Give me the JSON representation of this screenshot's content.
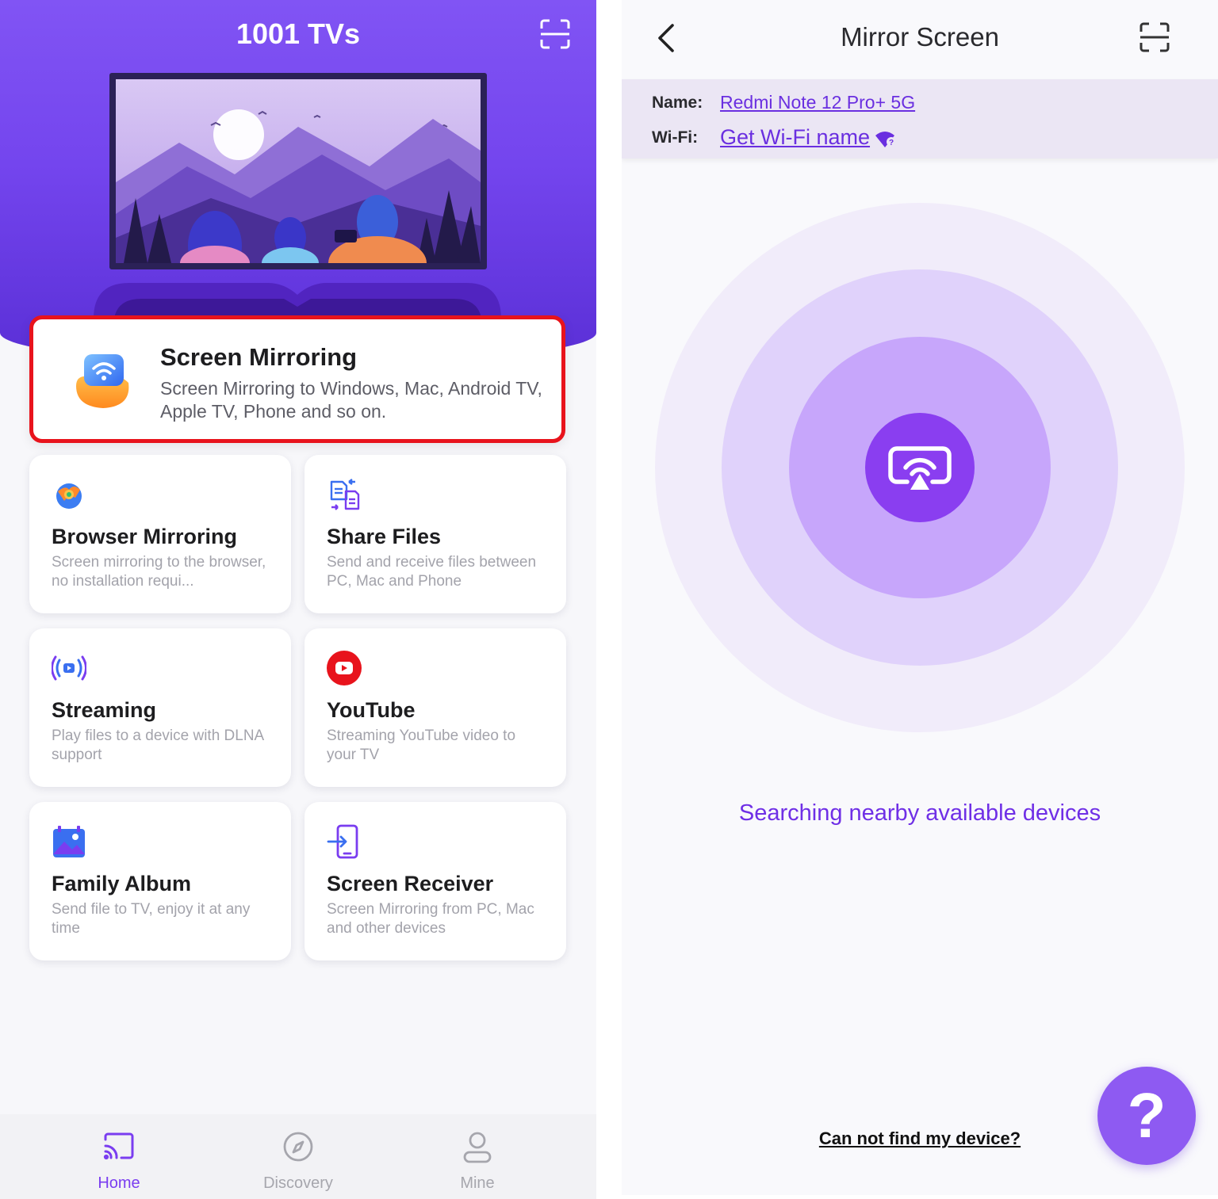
{
  "left": {
    "app_title": "1001 TVs",
    "main_feature": {
      "title": "Screen Mirroring",
      "description": "Screen Mirroring to Windows, Mac, Android TV, Apple TV, Phone and so on.",
      "highlight_color": "#e8131c"
    },
    "features": [
      {
        "title": "Browser Mirroring",
        "description": "Screen mirroring to the browser, no installation requi...",
        "icon": "browser-icon"
      },
      {
        "title": "Share Files",
        "description": "Send and receive files between PC, Mac and Phone",
        "icon": "share-files-icon"
      },
      {
        "title": "Streaming",
        "description": "Play files to a device with DLNA support",
        "icon": "streaming-icon"
      },
      {
        "title": "YouTube",
        "description": "Streaming YouTube video to your TV",
        "icon": "youtube-icon"
      },
      {
        "title": "Family Album",
        "description": "Send file to TV, enjoy it at any time",
        "icon": "album-icon"
      },
      {
        "title": "Screen Receiver",
        "description": "Screen Mirroring from PC, Mac and other devices",
        "icon": "receiver-icon"
      }
    ],
    "nav": [
      {
        "label": "Home",
        "icon": "cast-icon",
        "active": true
      },
      {
        "label": "Discovery",
        "icon": "compass-icon",
        "active": false
      },
      {
        "label": "Mine",
        "icon": "user-icon",
        "active": false
      }
    ]
  },
  "right": {
    "title": "Mirror Screen",
    "name_label": "Name:",
    "name_value": "Redmi Note 12 Pro+ 5G",
    "wifi_label": "Wi-Fi:",
    "wifi_value": "Get Wi-Fi name",
    "status": "Searching nearby available devices",
    "cannot_find": "Can not find my device?",
    "help_label": "?"
  },
  "colors": {
    "accent": "#7a3df0",
    "hero": "#7445ee",
    "radar_outer": "#f1ecfa",
    "radar_mid": "#e0d2fb",
    "radar_inner": "#c7a6fb",
    "radar_core": "#8a3ef0"
  }
}
